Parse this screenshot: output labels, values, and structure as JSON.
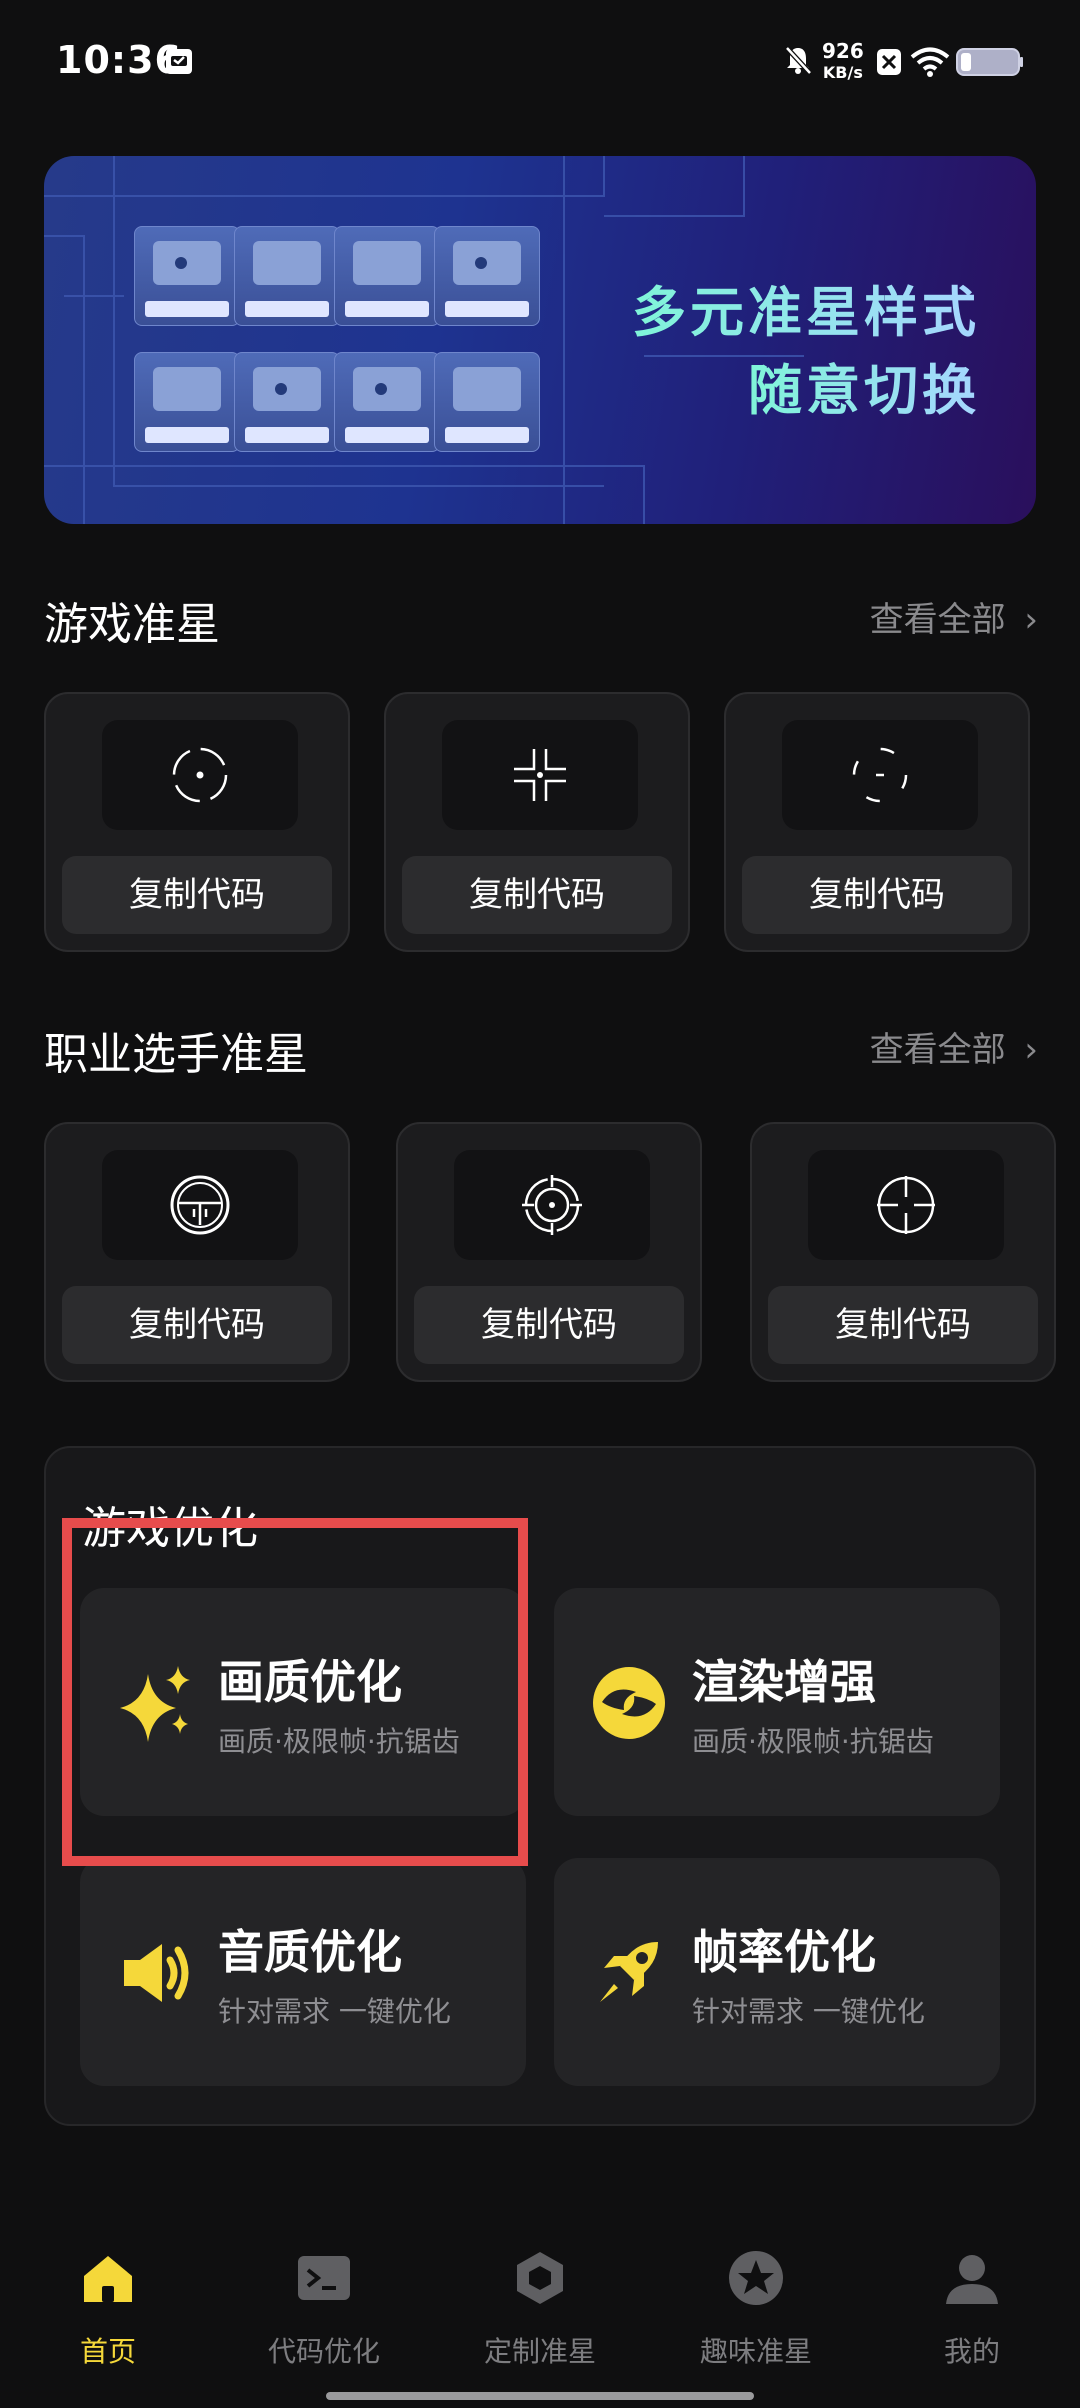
{
  "status_bar": {
    "time": "10:36",
    "net_speed_value": "926",
    "net_speed_unit": "KB/s"
  },
  "banner": {
    "line1": "多元准星样式",
    "line2": "随意切换"
  },
  "game_crosshair": {
    "title": "游戏准星",
    "see_all": "查看全部",
    "cards": [
      {
        "icon": "circle-dot-crosshair",
        "button": "复制代码"
      },
      {
        "icon": "corner-bracket-crosshair",
        "button": "复制代码"
      },
      {
        "icon": "split-circle-crosshair",
        "button": "复制代码"
      }
    ]
  },
  "pro_crosshair": {
    "title": "职业选手准星",
    "see_all": "查看全部",
    "cards": [
      {
        "icon": "t-scope-crosshair",
        "button": "复制代码"
      },
      {
        "icon": "target-ring-crosshair",
        "button": "复制代码"
      },
      {
        "icon": "cross-circle-crosshair",
        "button": "复制代码"
      }
    ]
  },
  "game_optimization": {
    "title": "游戏优化",
    "items": [
      {
        "name": "画质优化",
        "sub": "画质·极限帧·抗锯齿",
        "icon": "sparkle-icon"
      },
      {
        "name": "渲染增强",
        "sub": "画质·极限帧·抗锯齿",
        "icon": "swirl-icon"
      },
      {
        "name": "音质优化",
        "sub": "针对需求 一键优化",
        "icon": "speaker-icon"
      },
      {
        "name": "帧率优化",
        "sub": "针对需求 一键优化",
        "icon": "rocket-icon"
      }
    ]
  },
  "bottom_nav": {
    "items": [
      {
        "label": "首页",
        "icon": "home-icon",
        "active": true
      },
      {
        "label": "代码优化",
        "icon": "terminal-icon"
      },
      {
        "label": "定制准星",
        "icon": "hexagon-icon"
      },
      {
        "label": "趣味准星",
        "icon": "star-icon"
      },
      {
        "label": "我的",
        "icon": "person-icon"
      }
    ]
  },
  "colors": {
    "accent": "#f5d83a",
    "background": "#0f0f10",
    "highlight_border": "#e74c4c"
  }
}
